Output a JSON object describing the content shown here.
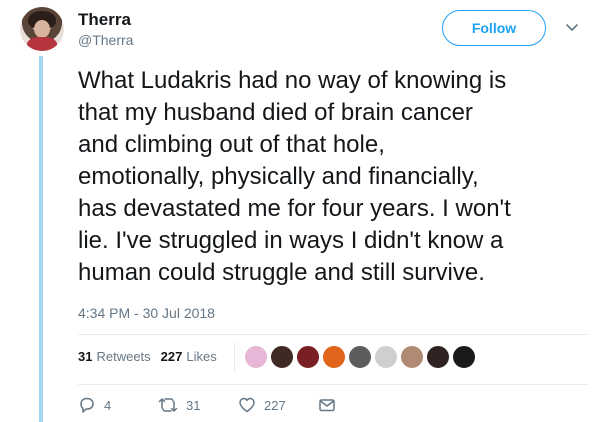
{
  "user": {
    "display_name": "Therra",
    "handle": "@Therra"
  },
  "header": {
    "follow_label": "Follow"
  },
  "tweet": {
    "lines": [
      "What Ludakris had no way of knowing is",
      "that my husband died of brain cancer",
      "and climbing out of that hole,",
      "emotionally, physically and financially,",
      "has devastated me for four years. I won't",
      "lie. I've struggled in ways I didn't know a",
      "human could struggle and still survive."
    ],
    "timestamp": "4:34 PM - 30 Jul 2018"
  },
  "stats": {
    "retweets_count": "31",
    "retweets_label": "Retweets",
    "likes_count": "227",
    "likes_label": "Likes"
  },
  "liker_avatars": [
    {
      "icon": "avatar-icon",
      "color": "#e7b7d8"
    },
    {
      "icon": "avatar-icon",
      "color": "#3e2a22"
    },
    {
      "icon": "avatar-icon",
      "color": "#7a1f24"
    },
    {
      "icon": "avatar-icon",
      "color": "#e0651a"
    },
    {
      "icon": "avatar-icon",
      "color": "#5d5d5d"
    },
    {
      "icon": "avatar-icon",
      "color": "#cfcfcf"
    },
    {
      "icon": "avatar-icon",
      "color": "#b08a72"
    },
    {
      "icon": "avatar-icon",
      "color": "#2e2320"
    },
    {
      "icon": "avatar-icon",
      "color": "#1a1a1a"
    }
  ],
  "actions": {
    "replies": "4",
    "retweets": "31",
    "likes": "227"
  },
  "colors": {
    "accent": "#1da1f2",
    "thread_line": "#a4d6f5",
    "muted": "#657786"
  }
}
